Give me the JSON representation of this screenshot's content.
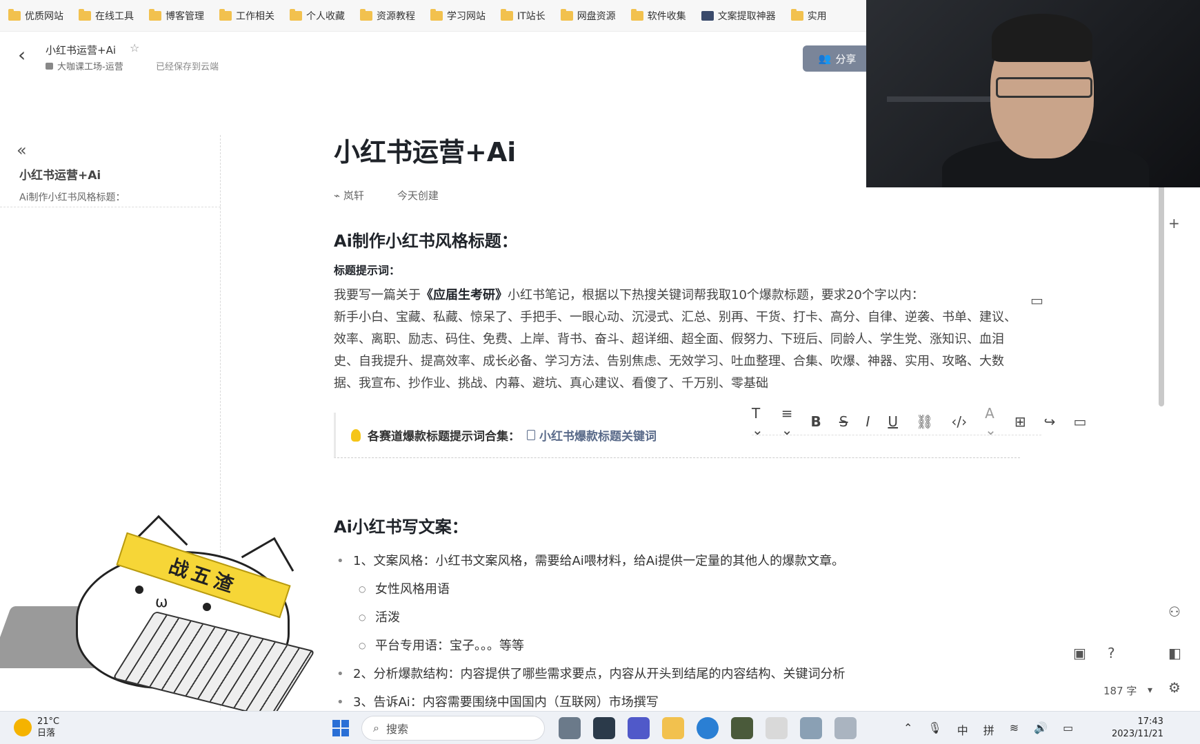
{
  "bookmarks": [
    {
      "label": "优质网站",
      "icon": "folder-icon"
    },
    {
      "label": "在线工具",
      "icon": "folder-icon"
    },
    {
      "label": "博客管理",
      "icon": "folder-icon"
    },
    {
      "label": "工作相关",
      "icon": "folder-icon"
    },
    {
      "label": "个人收藏",
      "icon": "folder-icon"
    },
    {
      "label": "资源教程",
      "icon": "folder-icon"
    },
    {
      "label": "学习网站",
      "icon": "folder-icon"
    },
    {
      "label": "IT站长",
      "icon": "folder-icon"
    },
    {
      "label": "网盘资源",
      "icon": "folder-icon"
    },
    {
      "label": "软件收集",
      "icon": "folder-icon"
    },
    {
      "label": "文案提取神器",
      "icon": "tool-icon"
    },
    {
      "label": "实用",
      "icon": "folder-icon"
    }
  ],
  "header": {
    "doc_title": "小红书运营+Ai",
    "breadcrumb": "大咖课工场-运营",
    "saved_status": "已经保存到云端",
    "share_label": "分享"
  },
  "sidebar": {
    "title": "小红书运营+Ai",
    "items": [
      "Ai制作小红书风格标题："
    ]
  },
  "doc": {
    "title": "小红书运营+Ai",
    "author": "岚轩",
    "created": "今天创建",
    "section1_heading": "Ai制作小红书风格标题：",
    "prompt_label": "标题提示词：",
    "prompt_pre": "我要写一篇关于",
    "prompt_bold": "《应届生考研》",
    "prompt_post": "小红书笔记，根据以下热搜关键词帮我取10个爆款标题，要求20个字以内：",
    "keywords": "新手小白、宝藏、私藏、惊呆了、手把手、一眼心动、沉浸式、汇总、别再、干货、打卡、高分、自律、逆袭、书单、建议、效率、离职、励志、码住、免费、上岸、背书、奋斗、超详细、超全面、假努力、下班后、同龄人、学生党、涨知识、血泪史、自我提升、提高效率、成长必备、学习方法、告别焦虑、无效学习、吐血整理、合集、吹爆、神器、实用、攻略、大数据、我宣布、抄作业、挑战、内幕、避坑、真心建议、看傻了、千万别、零基础",
    "callout_label": "各赛道爆款标题提示词合集：",
    "callout_link": "小红书爆款标题关键词",
    "section2_heading": "Ai小红书写文案：",
    "list": [
      {
        "level": 1,
        "text": "1、文案风格：小红书文案风格，需要给Ai喂材料，给Ai提供一定量的其他人的爆款文章。"
      },
      {
        "level": 2,
        "text": "女性风格用语"
      },
      {
        "level": 2,
        "text": "活泼"
      },
      {
        "level": 2,
        "text": "平台专用语：宝子。。。等等"
      },
      {
        "level": 1,
        "text": "2、分析爆款结构：内容提供了哪些需求要点，内容从开头到结尾的内容结构、关键词分析"
      },
      {
        "level": 1,
        "text": "3、告诉Ai：内容需要围绕中国国内（互联网）市场撰写"
      }
    ]
  },
  "toolbar": {
    "items": [
      "T",
      "≡",
      "B",
      "S",
      "I",
      "U",
      "🔗",
      "</>",
      "A"
    ]
  },
  "status": {
    "word_count": "187 字"
  },
  "sticker_text": "战五渣",
  "taskbar": {
    "temperature": "21°C",
    "weather": "日落",
    "search_placeholder": "搜索",
    "ime1": "中",
    "ime2": "拼",
    "time": "17:43",
    "date": "2023/11/21"
  }
}
